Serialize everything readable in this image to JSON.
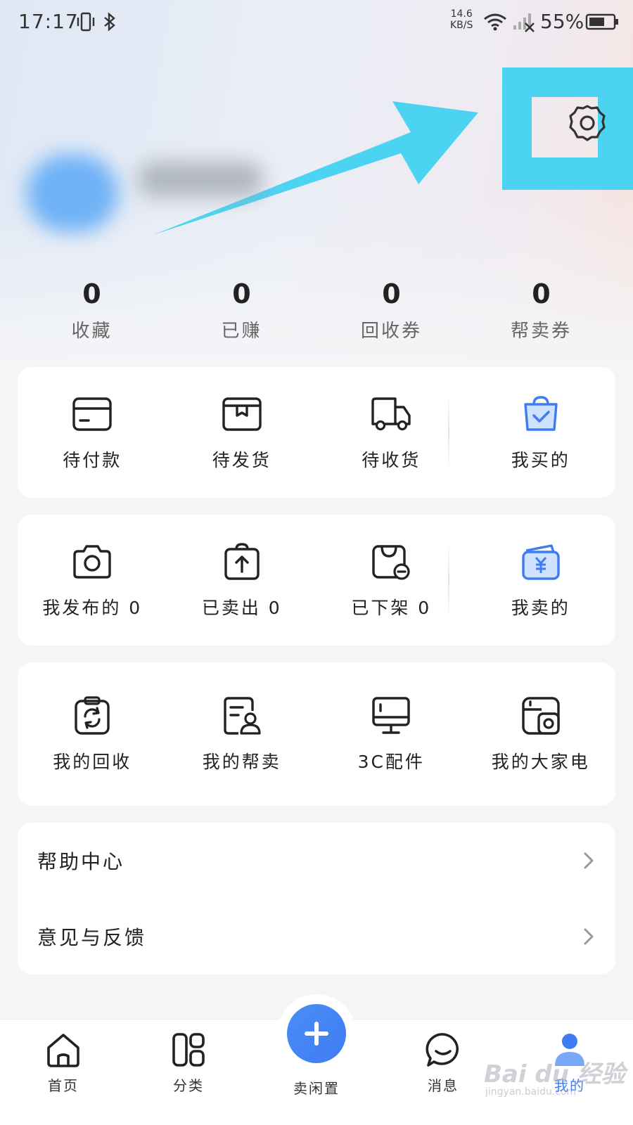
{
  "status_bar": {
    "time": "17:17",
    "net_speed_value": "14.6",
    "net_speed_unit": "KB/S",
    "battery": "55%"
  },
  "header": {
    "settings_icon": "gear-icon",
    "annotation_color": "#4dd3f2"
  },
  "stats": [
    {
      "value": "0",
      "label": "收藏"
    },
    {
      "value": "0",
      "label": "已赚"
    },
    {
      "value": "0",
      "label": "回收券"
    },
    {
      "value": "0",
      "label": "帮卖券"
    }
  ],
  "buy_section": {
    "items": [
      {
        "label": "待付款",
        "icon": "card-icon"
      },
      {
        "label": "待发货",
        "icon": "box-icon"
      },
      {
        "label": "待收货",
        "icon": "truck-icon"
      },
      {
        "label": "我买的",
        "icon": "shopping-bag-icon"
      }
    ]
  },
  "sell_section": {
    "items": [
      {
        "label": "我发布的 0",
        "icon": "camera-icon"
      },
      {
        "label": "已卖出 0",
        "icon": "upload-bag-icon"
      },
      {
        "label": "已下架 0",
        "icon": "remove-bag-icon"
      },
      {
        "label": "我卖的",
        "icon": "yuan-wallet-icon"
      }
    ]
  },
  "services": {
    "items": [
      {
        "label": "我的回收",
        "icon": "recycle-icon"
      },
      {
        "label": "我的帮卖",
        "icon": "assist-sell-icon"
      },
      {
        "label": "3C配件",
        "icon": "monitor-icon"
      },
      {
        "label": "我的大家电",
        "icon": "appliance-icon"
      }
    ]
  },
  "menu": [
    {
      "label": "帮助中心"
    },
    {
      "label": "意见与反馈"
    }
  ],
  "tabbar": {
    "items": [
      {
        "label": "首页",
        "icon": "home-icon"
      },
      {
        "label": "分类",
        "icon": "category-icon"
      },
      {
        "label": "卖闲置",
        "icon": "plus-icon"
      },
      {
        "label": "消息",
        "icon": "message-icon"
      },
      {
        "label": "我的",
        "icon": "user-icon"
      }
    ],
    "active_color": "#3f7cf2"
  },
  "watermark": {
    "text": "Bai du 经验",
    "url": "jingyan.baidu.com"
  }
}
